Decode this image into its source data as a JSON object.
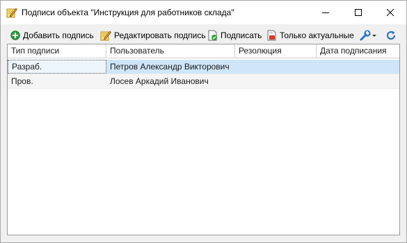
{
  "window": {
    "title": "Подписи объекта \"Инструкция для работников склада\""
  },
  "toolbar": {
    "add_label": "Добавить подпись",
    "edit_label": "Редактировать подпись",
    "sign_label": "Подписать",
    "actual_label": "Только актуальные"
  },
  "grid": {
    "columns": [
      "Тип подписи",
      "Пользователь",
      "Резолюция",
      "Дата подписания"
    ],
    "rows": [
      [
        "Разраб.",
        "Петров Александр Викторович",
        "",
        ""
      ],
      [
        "Пров.",
        "Лосев Аркадий Иванович",
        "",
        ""
      ]
    ],
    "selected_row": 0
  },
  "colors": {
    "selected_row": "#cfe6fa",
    "alt_row": "#f5f5f5",
    "add_icon": "#2e9b3a",
    "refresh_icon": "#2a74c9"
  },
  "icons": {
    "title": "pencil-notebook-icon",
    "add": "green-plus-icon",
    "edit": "pencil-notebook-icon",
    "sign": "document-check-icon",
    "actual": "document-red-icon",
    "tools": "wrench-dropdown-icon",
    "refresh": "refresh-icon"
  }
}
